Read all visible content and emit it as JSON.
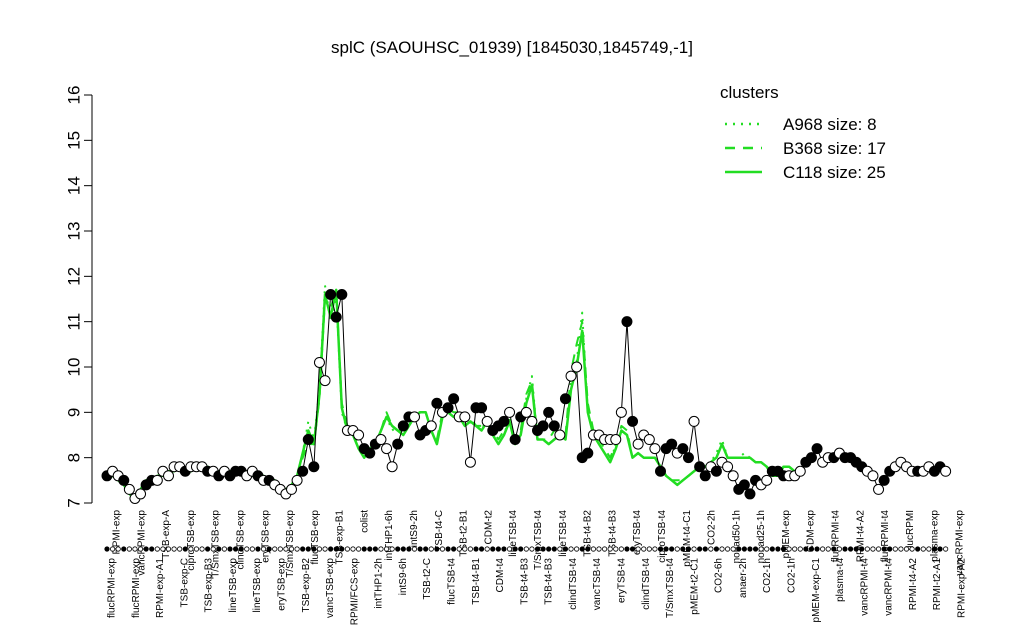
{
  "chart_data": {
    "type": "line",
    "title": "splC (SAOUHSC_01939) [1845030,1845749,-1]",
    "xlabel": "",
    "ylabel": "",
    "ylim": [
      7,
      16
    ],
    "yticks": [
      7,
      8,
      9,
      10,
      11,
      12,
      13,
      14,
      15,
      16
    ],
    "grid": false,
    "legend": {
      "title": "clusters",
      "placement": "top-right",
      "entries": [
        {
          "label": "A968 size: 8",
          "style": "dotted"
        },
        {
          "label": "B368 size: 17",
          "style": "dashed"
        },
        {
          "label": "C118 size: 25",
          "style": "solid"
        }
      ]
    },
    "series_color": "#22dd22",
    "x_tick_labels": [
      "flucRPMI-exp",
      "flucRPMI-exp",
      "RPMI-exp-A1",
      "TSB-exp-C",
      "TSB-exp-B3",
      "lineTSB-exp",
      "lineTSB-exp",
      "eryTSB-exp",
      "TSB-exp-B2",
      "vancTSB-exp",
      "RPMI/FCS-exp",
      "intTHP1-2h",
      "intS9-6h",
      "TSB-t2-C",
      "flucTSB-t4",
      "TSB-t4-B1",
      "CDM-t4",
      "TSB-t4-B3",
      "TSB-t4-B3",
      "clindTSB-t4",
      "vancTSB-t4",
      "eryTSB-t4",
      "clindTSB-t4",
      "T/SmxTSB-t4",
      "pMEM-t2-C1",
      "CO2-6h",
      "anaer-2h",
      "CO2-1h",
      "CO2-1h",
      "pMEM-exp-C1",
      "plasma-t4",
      "vancRPMI-t4",
      "vancRPMI-t4",
      "RPMI-t4-A2",
      "RPMI-t2-A1",
      "RPMI-exp-A2"
    ],
    "top_labels": [
      "RPMI-exp",
      "vancRPMI-exp",
      "TSB-exp-A",
      "ciproTSB-exp",
      "T/SmxTSB-exp",
      "clindTSB-exp",
      "eryTSB-exp",
      "T/SmxTSB-exp",
      "flucTSB-exp",
      "TSB-exp-B1",
      "colist",
      "intTHP1-6h",
      "intS9-2h",
      "TSB-t4-C",
      "TSB-t2-B1",
      "CDM-t2",
      "lineTSB-t4",
      "T/SmxTSB-t4",
      "lineTSB-t4",
      "TSB-t4-B2",
      "TSB-t4-B3",
      "eryTSB-t4",
      "ciproTSB-t4",
      "pMEM-t4-C1",
      "CO2-2h",
      "nonad50-1h",
      "nonad25-1h",
      "pMEM-exp",
      "CDM-exp",
      "flucRPMI-t4",
      "RPMI-t4-A2",
      "flucRPMI-t4",
      "flucRPMI",
      "plasma-exp",
      "vancRPMI-exp"
    ],
    "x": [
      1,
      2,
      3,
      4,
      5,
      6,
      7,
      8,
      9,
      10,
      11,
      12,
      13,
      14,
      15,
      16,
      17,
      18,
      19,
      20,
      21,
      22,
      23,
      24,
      25,
      26,
      27,
      28,
      29,
      30,
      31,
      32,
      33,
      34,
      35,
      36,
      37,
      38,
      39,
      40,
      41,
      42,
      43,
      44,
      45,
      46,
      47,
      48,
      49,
      50,
      51,
      52,
      53,
      54,
      55,
      56,
      57,
      58,
      59,
      60,
      61,
      62,
      63,
      64,
      65,
      66,
      67,
      68,
      69,
      70,
      71,
      72,
      73,
      74,
      75,
      76,
      77,
      78,
      79,
      80,
      81,
      82,
      83,
      84,
      85,
      86,
      87,
      88,
      89,
      90,
      91,
      92,
      93,
      94,
      95,
      96,
      97,
      98,
      99,
      100,
      101,
      102,
      103,
      104,
      105,
      106,
      107,
      108,
      109,
      110,
      111,
      112,
      113,
      114,
      115,
      116,
      117,
      118,
      119,
      120,
      121,
      122,
      123,
      124,
      125,
      126,
      127,
      128,
      129,
      130,
      131,
      132,
      133,
      134,
      135,
      136,
      137,
      138,
      139,
      140,
      141,
      142,
      143,
      144,
      145,
      146,
      147,
      148,
      149,
      150,
      151,
      152,
      153,
      154,
      155
    ],
    "series": [
      {
        "values": [
          7.6,
          7.6,
          7.5,
          7.4,
          7.2,
          7.1,
          7.3,
          7.5,
          7.5,
          7.6,
          7.6,
          7.7,
          7.7,
          7.8,
          7.7,
          7.7,
          7.8,
          7.8,
          7.8,
          7.7,
          7.7,
          7.7,
          7.7,
          7.7,
          7.7,
          7.7,
          7.6,
          7.6,
          7.6,
          7.5,
          7.5,
          7.3,
          7.3,
          7.4,
          7.6,
          8.1,
          8.8,
          8.4,
          9.5,
          11.8,
          11.0,
          11.6,
          9.0,
          8.6,
          8.5,
          8.2,
          8.0,
          8.1,
          8.3,
          8.6,
          8.9,
          8.6,
          8.7,
          8.6,
          8.8,
          8.9,
          9.0,
          9.0,
          8.6,
          8.3,
          8.9,
          9.1,
          9.0,
          8.9,
          8.7,
          8.8,
          8.7,
          8.6,
          8.9,
          8.5,
          8.3,
          8.5,
          8.9,
          8.3,
          8.5,
          9.3,
          9.8,
          8.4,
          8.4,
          8.3,
          8.4,
          8.6,
          8.4,
          9.7,
          10.1,
          11.2,
          9.0,
          8.5,
          8.3,
          8.1,
          7.9,
          8.3,
          8.6,
          8.5,
          8.0,
          8.1,
          8.0,
          8.0,
          8.0,
          7.8,
          7.6,
          7.5,
          7.4,
          7.5,
          7.6,
          7.7,
          7.8,
          7.8,
          7.9,
          8.1,
          8.4,
          8.0,
          8.0,
          8.0,
          8.1,
          8.0,
          7.9,
          7.9,
          7.8,
          7.6,
          7.6,
          7.8,
          7.8,
          7.7
        ]
      },
      {
        "values": [
          7.6,
          7.6,
          7.5,
          7.4,
          7.2,
          7.1,
          7.3,
          7.5,
          7.5,
          7.6,
          7.6,
          7.7,
          7.7,
          7.8,
          7.7,
          7.7,
          7.8,
          7.8,
          7.8,
          7.7,
          7.7,
          7.7,
          7.7,
          7.7,
          7.7,
          7.6,
          7.6,
          7.6,
          7.6,
          7.5,
          7.5,
          7.3,
          7.3,
          7.4,
          7.6,
          8.0,
          8.3,
          8.3,
          9.3,
          11.5,
          11.3,
          11.7,
          9.2,
          8.7,
          8.5,
          8.3,
          8.1,
          8.2,
          8.3,
          8.6,
          9.0,
          8.7,
          8.6,
          8.6,
          8.9,
          9.0,
          9.0,
          9.0,
          8.6,
          8.4,
          9.0,
          9.1,
          9.0,
          9.0,
          8.8,
          8.9,
          8.7,
          8.7,
          8.8,
          8.6,
          8.4,
          8.6,
          8.8,
          8.4,
          8.6,
          9.4,
          9.7,
          8.4,
          8.4,
          8.4,
          8.6,
          8.6,
          8.5,
          9.9,
          10.5,
          11.0,
          9.2,
          8.6,
          8.4,
          8.2,
          8.0,
          8.3,
          8.7,
          8.6,
          8.0,
          8.1,
          8.0,
          8.0,
          8.0,
          7.8,
          7.6,
          7.5,
          7.5,
          7.5,
          7.6,
          7.7,
          7.8,
          7.8,
          7.9,
          8.0,
          8.3,
          8.0,
          8.0,
          8.0,
          8.0,
          8.0,
          7.9,
          7.9,
          7.8,
          7.7,
          7.7,
          7.8,
          7.8,
          7.7
        ]
      },
      {
        "values": [
          7.6,
          7.6,
          7.5,
          7.4,
          7.2,
          7.1,
          7.3,
          7.5,
          7.5,
          7.6,
          7.6,
          7.7,
          7.7,
          7.8,
          7.7,
          7.7,
          7.8,
          7.8,
          7.8,
          7.7,
          7.7,
          7.7,
          7.7,
          7.7,
          7.7,
          7.6,
          7.6,
          7.6,
          7.6,
          7.5,
          7.5,
          7.3,
          7.3,
          7.4,
          7.6,
          8.1,
          8.6,
          8.3,
          9.4,
          11.6,
          11.1,
          11.7,
          9.1,
          8.6,
          8.5,
          8.2,
          8.0,
          8.2,
          8.3,
          8.6,
          8.9,
          8.7,
          8.6,
          8.5,
          8.7,
          8.9,
          9.0,
          9.0,
          8.6,
          8.3,
          8.9,
          9.0,
          8.9,
          8.9,
          8.7,
          8.8,
          8.7,
          8.6,
          8.8,
          8.5,
          8.3,
          8.5,
          8.8,
          8.3,
          8.5,
          9.2,
          9.6,
          8.4,
          8.4,
          8.3,
          8.4,
          8.5,
          8.4,
          9.5,
          10.0,
          10.8,
          9.0,
          8.5,
          8.3,
          8.1,
          7.9,
          8.2,
          8.6,
          8.5,
          8.0,
          8.1,
          8.0,
          8.0,
          8.0,
          7.8,
          7.6,
          7.5,
          7.4,
          7.5,
          7.6,
          7.7,
          7.8,
          7.8,
          7.9,
          8.0,
          8.3,
          8.0,
          8.0,
          8.0,
          8.0,
          8.0,
          7.9,
          7.9,
          7.8,
          7.6,
          7.6,
          7.8,
          7.8,
          7.7
        ]
      }
    ],
    "points": {
      "x": [
        1,
        2,
        3,
        4,
        5,
        6,
        7,
        8,
        9,
        10,
        11,
        12,
        13,
        14,
        15,
        16,
        17,
        18,
        19,
        20,
        21,
        22,
        23,
        24,
        25,
        26,
        27,
        28,
        29,
        30,
        31,
        32,
        33,
        34,
        35,
        36,
        37,
        38,
        39,
        40,
        41,
        42,
        43,
        44,
        45,
        46,
        47,
        48,
        49,
        50,
        51,
        52,
        53,
        54,
        55,
        56,
        57,
        58,
        59,
        60,
        61,
        62,
        63,
        64,
        65,
        66,
        67,
        68,
        69,
        70,
        71,
        72,
        73,
        74,
        75,
        76,
        77,
        78,
        79,
        80,
        81,
        82,
        83,
        84,
        85,
        86,
        87,
        88,
        89,
        90,
        91,
        92,
        93,
        94,
        95,
        96,
        97,
        98,
        99,
        100,
        101,
        102,
        103,
        104,
        105,
        106,
        107,
        108,
        109,
        110,
        111,
        112,
        113,
        114,
        115,
        116,
        117,
        118,
        119,
        120,
        121,
        122,
        123,
        124,
        125,
        126,
        127,
        128,
        129,
        130,
        131,
        132,
        133,
        134,
        135,
        136,
        137,
        138,
        139,
        140,
        141,
        142,
        143,
        144,
        145,
        146,
        147,
        148,
        149,
        150,
        151,
        152,
        153,
        154,
        155
      ],
      "y": [
        7.6,
        7.7,
        7.6,
        7.5,
        7.3,
        7.1,
        7.2,
        7.4,
        7.5,
        7.5,
        7.7,
        7.6,
        7.8,
        7.8,
        7.7,
        7.8,
        7.8,
        7.8,
        7.7,
        7.7,
        7.6,
        7.7,
        7.6,
        7.7,
        7.7,
        7.6,
        7.7,
        7.6,
        7.5,
        7.5,
        7.4,
        7.3,
        7.2,
        7.3,
        7.5,
        7.7,
        8.4,
        7.8,
        10.1,
        9.7,
        11.6,
        11.1,
        11.6,
        8.6,
        8.6,
        8.5,
        8.2,
        8.1,
        8.3,
        8.4,
        8.2,
        7.8,
        8.3,
        8.7,
        8.9,
        8.9,
        8.5,
        8.6,
        8.7,
        9.2,
        9.0,
        9.1,
        9.3,
        8.9,
        8.9,
        7.9,
        9.1,
        9.1,
        8.8,
        8.6,
        8.7,
        8.8,
        9.0,
        8.4,
        8.9,
        9.0,
        8.8,
        8.6,
        8.7,
        9.0,
        8.7,
        8.5,
        9.3,
        9.8,
        10.0,
        8.0,
        8.1,
        8.5,
        8.5,
        8.4,
        8.4,
        8.4,
        9.0,
        11.0,
        8.8,
        8.3,
        8.5,
        8.4,
        8.2,
        7.7,
        8.2,
        8.3,
        8.1,
        8.2,
        8.0,
        8.8,
        7.8,
        7.6,
        7.8,
        7.7,
        7.9,
        7.8,
        7.6,
        7.3,
        7.4,
        7.2,
        7.5,
        7.4,
        7.5,
        7.7,
        7.7,
        7.6,
        7.6,
        7.6,
        7.7,
        7.9,
        8.0,
        8.2,
        7.9,
        8.0,
        8.0,
        8.1,
        8.0,
        8.0,
        7.9,
        7.8,
        7.7,
        7.6,
        7.3,
        7.5,
        7.7,
        7.8,
        7.9,
        7.8,
        7.7,
        7.7,
        7.7,
        7.8,
        7.7,
        7.8,
        7.7
      ],
      "filled": [
        1,
        0,
        0,
        1,
        0,
        0,
        0,
        1,
        1,
        0,
        0,
        0,
        0,
        0,
        1,
        0,
        0,
        0,
        1,
        0,
        1,
        0,
        1,
        1,
        1,
        0,
        0,
        1,
        0,
        1,
        0,
        0,
        0,
        0,
        0,
        1,
        1,
        1,
        0,
        0,
        1,
        1,
        1,
        0,
        0,
        0,
        1,
        1,
        1,
        0,
        0,
        0,
        1,
        1,
        1,
        0,
        1,
        1,
        0,
        1,
        0,
        1,
        1,
        0,
        0,
        0,
        1,
        1,
        0,
        1,
        1,
        1,
        0,
        1,
        1,
        0,
        0,
        1,
        1,
        1,
        1,
        0,
        1,
        0,
        0,
        1,
        1,
        0,
        0,
        0,
        0,
        0,
        0,
        1,
        1,
        0,
        0,
        0,
        0,
        1,
        1,
        1,
        0,
        1,
        1,
        0,
        1,
        1,
        0,
        1,
        0,
        0,
        0,
        1,
        1,
        1,
        1,
        0,
        0,
        1,
        1,
        1,
        0,
        0,
        0,
        1,
        1,
        1,
        0,
        0,
        1,
        0,
        1,
        1,
        1,
        1,
        0,
        0,
        0,
        1,
        1,
        0,
        0,
        0,
        0,
        1,
        0,
        0,
        1,
        1,
        0,
        0,
        1,
        0,
        0
      ]
    }
  }
}
